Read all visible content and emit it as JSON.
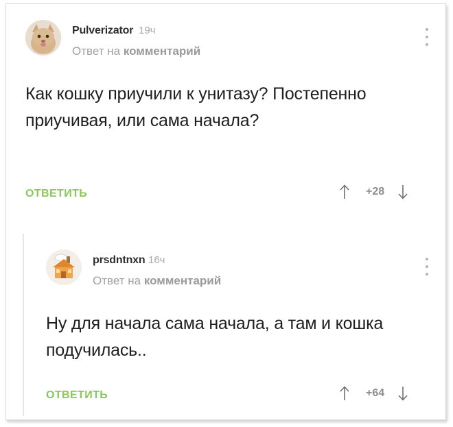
{
  "comments": [
    {
      "username": "Pulverizator",
      "time": "19ч",
      "reply_prefix": "Ответ на",
      "reply_target": "комментарий",
      "text": "Как кошку приучили к унитазу? Постепенно приучивая, или сама начала?",
      "reply_label": "ОТВЕТИТЬ",
      "score": "+28",
      "avatar": "cat-avatar"
    },
    {
      "username": "prsdntnxn",
      "time": "16ч",
      "reply_prefix": "Ответ на",
      "reply_target": "комментарий",
      "text": "Ну для начала сама начала, а там и кошка подучилась..",
      "reply_label": "ОТВЕТИТЬ",
      "score": "+64",
      "avatar": "cottage-avatar"
    }
  ],
  "colors": {
    "accent_green": "#8ac858",
    "muted_gray": "#a2a2a2",
    "text_dark": "#1f1f1f"
  }
}
